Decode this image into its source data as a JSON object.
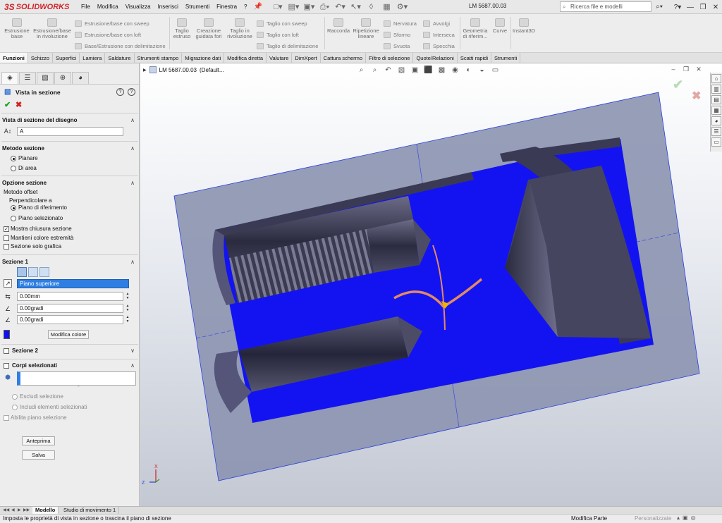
{
  "app": {
    "logo_ds": "3S",
    "logo_text": "SOLIDWORKS",
    "document_title": "LM 5687.00.03"
  },
  "menu": [
    "File",
    "Modifica",
    "Visualizza",
    "Inserisci",
    "Strumenti",
    "Finestra",
    "?"
  ],
  "search": {
    "placeholder": "Ricerca file e modelli"
  },
  "ribbon": {
    "estrusione_base": "Estrusione base",
    "estrusione_rivoluzione": "Estrusione/base in rivoluzione",
    "estrusione_sweep": "Estrusione/base con sweep",
    "estrusione_loft": "Estrusione/base con loft",
    "base_delimitazione": "Base/Estrusione con delimitazione",
    "taglio_estruso": "Taglio estruso",
    "creazione_fori": "Creazione guidata fori",
    "taglio_rivoluzione": "Taglio in rivoluzione",
    "taglio_sweep": "Taglio con sweep",
    "taglio_loft": "Taglio con loft",
    "taglio_delimitazione": "Taglio di delimitazione",
    "raccorda": "Raccorda",
    "ripetizione_lineare": "Ripetizione lineare",
    "nervatura": "Nervatura",
    "sformo": "Sformo",
    "svuota": "Svuota",
    "avvolgi": "Avvolgi",
    "interseca": "Interseca",
    "specchia": "Specchia",
    "geometria_riferimento": "Geometria di riferim...",
    "curve": "Curve",
    "instant3d": "Instant3D"
  },
  "tabs": [
    "Funzioni",
    "Schizzo",
    "Superfici",
    "Lamiera",
    "Saldature",
    "Strumenti stampo",
    "Migrazione dati",
    "Modifica diretta",
    "Valutare",
    "DimXpert",
    "Cattura schermo",
    "Filtro di selezione",
    "Quote/Relazioni",
    "Scatti rapidi",
    "Strumenti"
  ],
  "pm": {
    "title": "Vista in sezione",
    "group_section_view": "Vista di sezione del disegno",
    "section_name": "A",
    "group_method": "Metodo sezione",
    "method_planar": "Planare",
    "method_area": "Di area",
    "group_options": "Opzione sezione",
    "offset_method": "Metodo offset",
    "perpendicular": "Perpendicolare a",
    "ref_plane": "Piano di riferimento",
    "sel_plane": "Piano selezionato",
    "show_cap": "Mostra chiusura sezione",
    "keep_cap_color": "Mantieni colore estremità",
    "graphics_only": "Sezione solo grafica",
    "group_section1": "Sezione 1",
    "plane_selected": "Piano superiore",
    "offset": "0.00mm",
    "angle_x": "0.00gradi",
    "angle_y": "0.00gradi",
    "edit_color": "Modifica colore",
    "group_section2": "Sezione 2",
    "group_bodies": "Corpi selezionati",
    "exclude_sel": "Escludi selezione",
    "include_sel": "Includi elementi selezionati",
    "enable_plane_sel": "Abilita piano selezione",
    "preview_btn": "Anteprima",
    "save_btn": "Salva"
  },
  "viewport": {
    "tree_node": "LM 5687.00.03",
    "tree_config": "(Default..."
  },
  "triad": {
    "z": "Z",
    "x": "X"
  },
  "bottom_tabs": [
    "Modello",
    "Studio di movimento 1"
  ],
  "status": {
    "message": "Imposta le proprietà di vista in sezione o trascina il piano di sezione",
    "mode": "Modifica Parte",
    "custom": "Personalizzate"
  },
  "colors": {
    "section_cap": "#1313f2",
    "solid_dark": "#3a3a55",
    "plane": "#8c93b0",
    "handle": "#e28a62",
    "accent": "#2f7fe2"
  }
}
